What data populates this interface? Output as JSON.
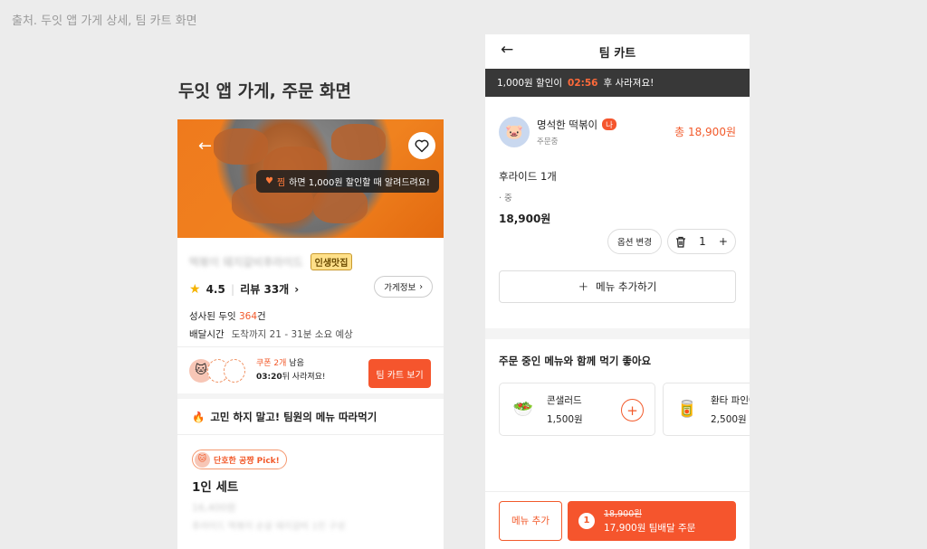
{
  "caption": "출처. 두잇 앱 가게 상세, 팀 카트 화면",
  "left_title": "두잇 앱 가게, 주문 화면",
  "store": {
    "tooltip_accent": "찜",
    "tooltip_rest": "하면 1,000원 할인할 때 알려드려요!",
    "name_blurred": "떡볶이 돼지갈비후라이드",
    "badge": "인생맛집",
    "rating": "4.5",
    "reviews": "리뷰 33개",
    "info_button": "가게정보",
    "success_prefix": "성사된 두잇 ",
    "success_count": "364",
    "success_suffix": "건",
    "delivery_label": "배달시간",
    "delivery_value": "도착까지 21 - 31분 소요 예상",
    "coupon_count": "쿠폰 2개",
    "coupon_count_suffix": " 남음",
    "coupon_time": "03:20",
    "coupon_time_suffix": "뒤 사라져요!",
    "team_cart_button": "팀 카트 보기",
    "follow_title": "고민 하지 말고! 팀원의 메뉴 따라먹기",
    "pick_label": "단호한 공쨩 Pick!",
    "set_title": "1인 세트",
    "set_price_blurred": "16,400원",
    "set_desc_blurred": "후라이드 떡볶이 순살 돼지갈비 1인 구성"
  },
  "team_cart": {
    "title": "팀 카트",
    "banner_prefix": "1,000원 할인이",
    "banner_timer": "02:56",
    "banner_suffix": "후 사라져요!",
    "member_name": "명석한 떡볶이",
    "member_badge": "나",
    "member_status": "주문중",
    "member_total": "총 18,900원",
    "item_name": "후라이드 1개",
    "item_option": "· 중",
    "item_price": "18,900원",
    "option_change": "옵션 변경",
    "quantity": "1",
    "add_menu": "메뉴 추가하기",
    "rec_title": "주문 중인 메뉴와 함께 먹기 좋아요",
    "recommendations": [
      {
        "name": "콘샐러드",
        "price": "1,500원",
        "icon": "salad-icon"
      },
      {
        "name": "환타 파인애플",
        "price": "2,500원",
        "icon": "soda-can-icon"
      }
    ],
    "bottom_menu_add": "메뉴 추가",
    "order_count": "1",
    "order_old_price": "18,900원",
    "order_new_label": "17,900원 팀배달 주문"
  },
  "colors": {
    "accent": "#f5552d",
    "banner_bg": "#383838",
    "badge_yellow": "#ffe08a"
  }
}
